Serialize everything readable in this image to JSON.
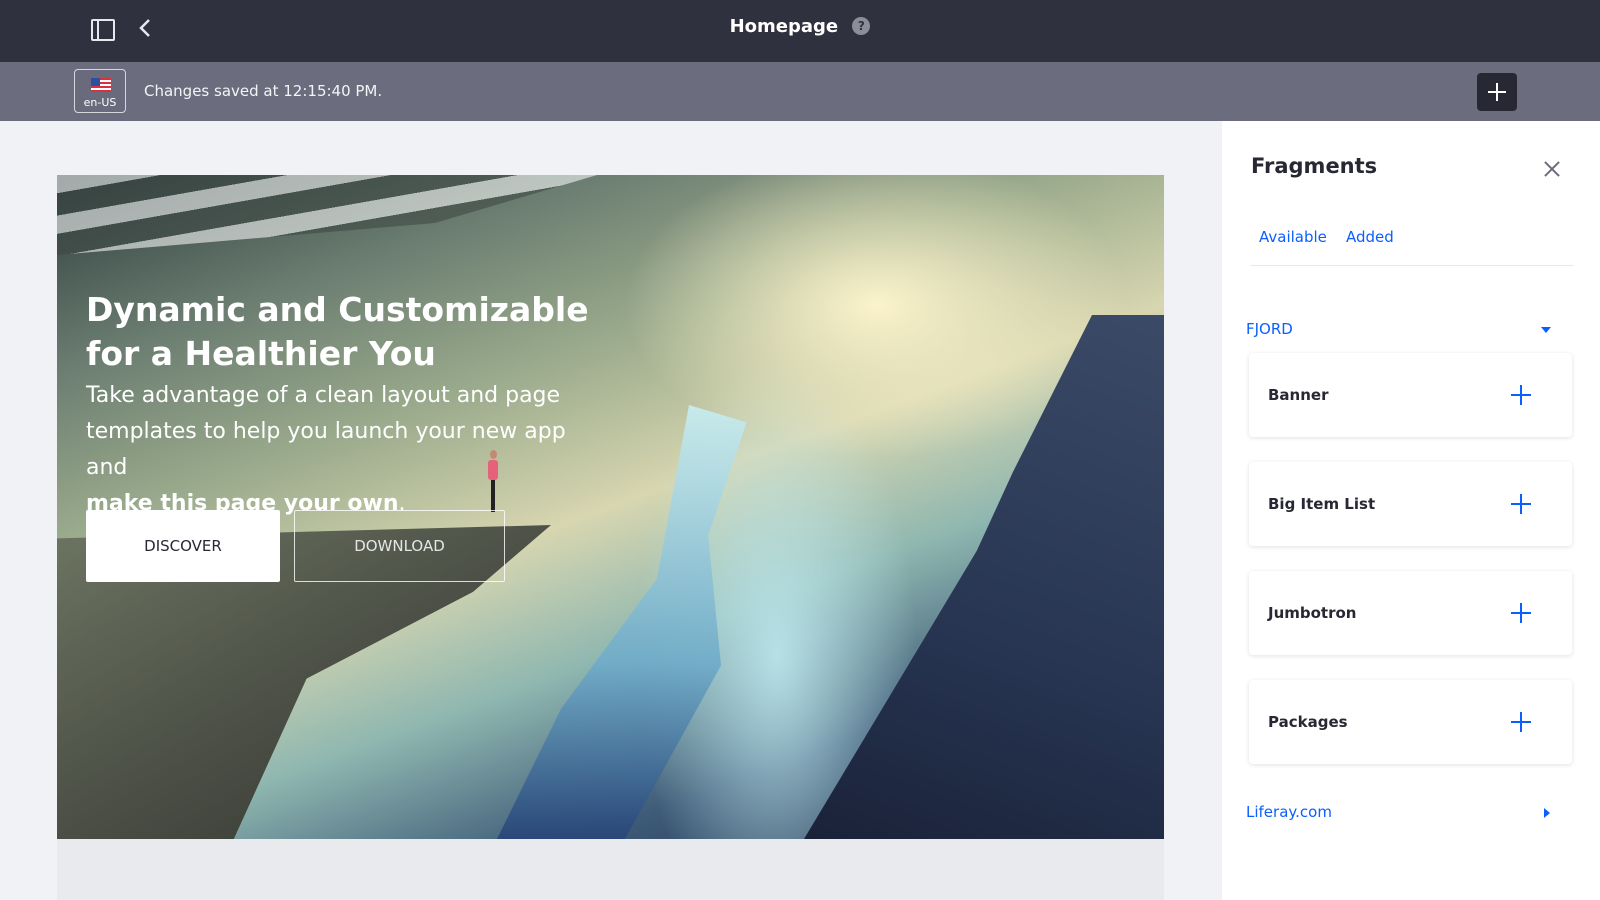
{
  "header": {
    "title": "Homepage",
    "help_icon": "?"
  },
  "statusbar": {
    "locale": "en-US",
    "save_status": "Changes saved at 12:15:40 PM."
  },
  "hero": {
    "title_line1": "Dynamic and Customizable",
    "title_line2": "for a Healthier You",
    "body_line1": "Take advantage of a clean layout and page",
    "body_line2": "templates to help you launch your new app and",
    "body_bold": "make this page your own",
    "body_end": ".",
    "discover_label": "DISCOVER",
    "download_label": "DOWNLOAD"
  },
  "panel": {
    "title": "Fragments",
    "tabs": [
      {
        "label": "Available"
      },
      {
        "label": "Added"
      }
    ],
    "collections": [
      {
        "name": "FJORD",
        "items": [
          {
            "label": "Banner"
          },
          {
            "label": "Big Item List"
          },
          {
            "label": "Jumbotron"
          },
          {
            "label": "Packages"
          }
        ]
      },
      {
        "name": "Liferay.com"
      }
    ]
  },
  "colors": {
    "topbar": "#30313f",
    "statusbar": "#6b6c7e",
    "accent": "#0b5fff"
  }
}
